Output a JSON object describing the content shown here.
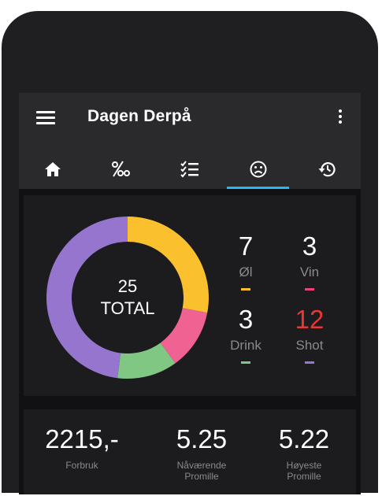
{
  "app": {
    "title": "Dagen Derpå"
  },
  "tabs": [
    {
      "icon": "home-icon",
      "active": false
    },
    {
      "icon": "permille-icon",
      "active": false
    },
    {
      "icon": "checklist-icon",
      "active": false
    },
    {
      "icon": "sad-face-icon",
      "active": true
    },
    {
      "icon": "history-icon",
      "active": false
    }
  ],
  "summary": {
    "total_value": "25",
    "total_label": "TOTAL"
  },
  "drinks": [
    {
      "count": "7",
      "label": "Øl",
      "color": "#fbc02d"
    },
    {
      "count": "3",
      "label": "Vin",
      "color": "#ec407a"
    },
    {
      "count": "3",
      "label": "Drink",
      "color": "#81c784"
    },
    {
      "count": "12",
      "label": "Shot",
      "color": "#9575cd"
    }
  ],
  "chart_data": {
    "type": "pie",
    "categories": [
      "Øl",
      "Vin",
      "Drink",
      "Shot"
    ],
    "values": [
      7,
      3,
      3,
      12
    ],
    "colors": [
      "#fbc02d",
      "#f06292",
      "#81c784",
      "#9575cd"
    ]
  },
  "stats": {
    "forbruk": {
      "value": "2215,-",
      "label": "Forbruk"
    },
    "current": {
      "value": "5.25",
      "label": "Nåværende\nPromille"
    },
    "max": {
      "value": "5.22",
      "label": "Høyeste\nPromille"
    }
  }
}
